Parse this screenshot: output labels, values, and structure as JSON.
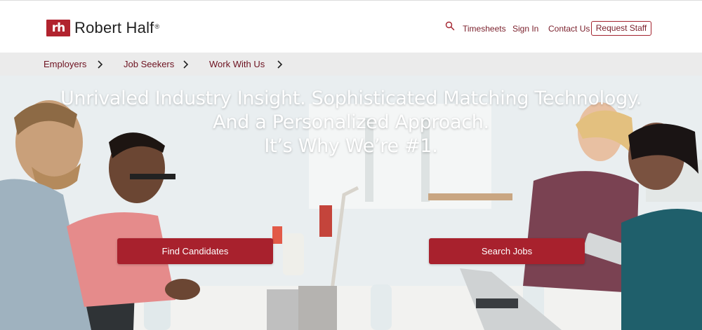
{
  "brand": {
    "logo_mark": "rh",
    "name": "Robert Half",
    "registered": "®",
    "color": "#b1232e"
  },
  "topnav": {
    "search_icon": "search-icon",
    "links": [
      "Timesheets",
      "Sign In",
      "Contact Us"
    ],
    "request_button": "Request Staff"
  },
  "subnav": {
    "items": [
      "Employers",
      "Job Seekers",
      "Work With Us"
    ],
    "chevron_icon": "chevron-right-icon"
  },
  "hero": {
    "headline": [
      "Unrivaled Industry Insight. Sophisticated Matching Technology.",
      "And a Personalized Approach.",
      "It’s Why We’re #1."
    ],
    "find_candidates": "Find Candidates",
    "search_jobs": "Search Jobs",
    "button_color": "#a8212d"
  }
}
